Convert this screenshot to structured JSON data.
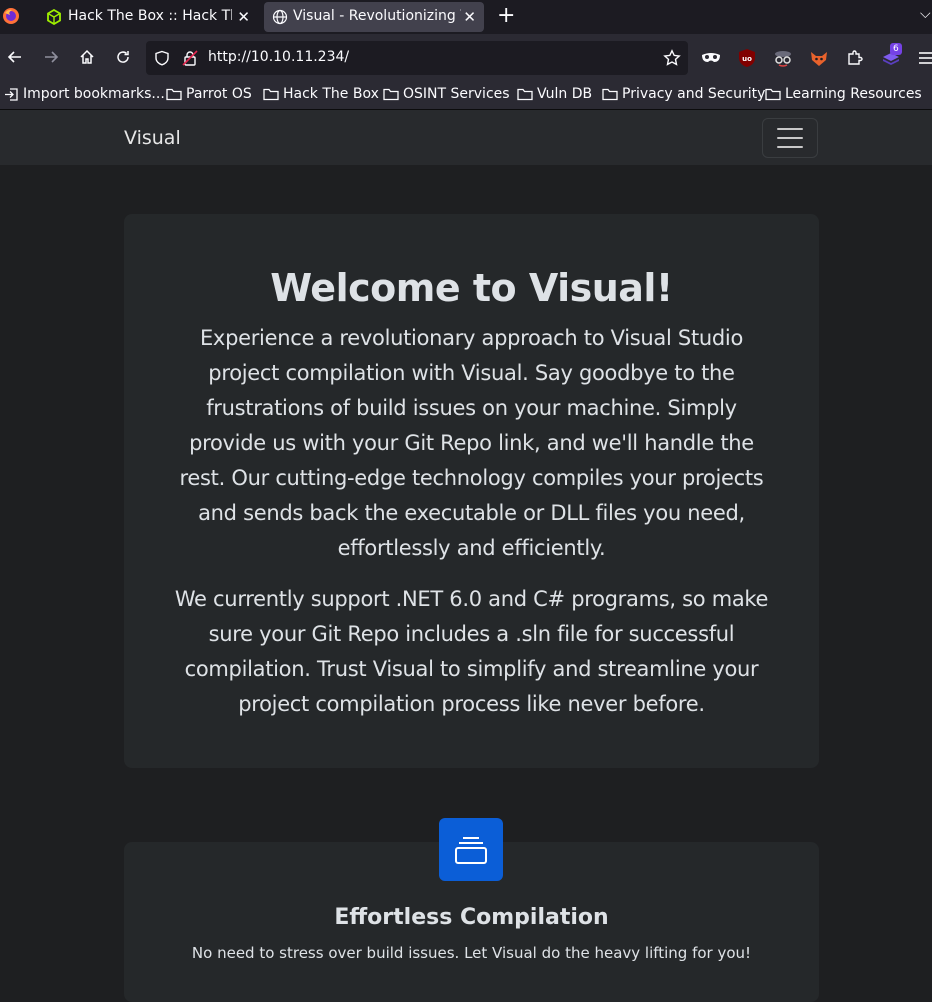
{
  "browser": {
    "tabs": [
      {
        "title": "Hack The Box :: Hack The",
        "icon": "hackthebox-icon",
        "active": false
      },
      {
        "title": "Visual - Revolutionizing V",
        "icon": "globe-icon",
        "active": true
      }
    ],
    "new_tab_label": "+",
    "url": "http://10.10.11.234/",
    "extension_badge": "6",
    "bookmarks": [
      {
        "label": "Import bookmarks...",
        "icon": "import-icon"
      },
      {
        "label": "Parrot OS",
        "icon": "folder-icon"
      },
      {
        "label": "Hack The Box",
        "icon": "folder-icon"
      },
      {
        "label": "OSINT Services",
        "icon": "folder-icon"
      },
      {
        "label": "Vuln DB",
        "icon": "folder-icon"
      },
      {
        "label": "Privacy and Security",
        "icon": "folder-icon"
      },
      {
        "label": "Learning Resources",
        "icon": "folder-icon"
      }
    ]
  },
  "site": {
    "brand": "Visual",
    "hero": {
      "title": "Welcome to Visual!",
      "paragraph1": "Experience a revolutionary approach to Visual Studio project compilation with Visual. Say goodbye to the frustrations of build issues on your machine. Simply provide us with your Git Repo link, and we'll handle the rest. Our cutting-edge technology compiles your projects and sends back the executable or DLL files you need, effortlessly and efficiently.",
      "paragraph2": "We currently support .NET 6.0 and C# programs, so make sure your Git Repo includes a .sln file for successful compilation. Trust Visual to simplify and streamline your project compilation process like never before."
    },
    "feature": {
      "icon": "collection-icon",
      "title": "Effortless Compilation",
      "text": "No need to stress over build issues. Let Visual do the heavy lifting for you!"
    }
  },
  "colors": {
    "accent": "#0b5ed7",
    "page_bg": "#1e1f21",
    "card_bg": "#25282a"
  }
}
